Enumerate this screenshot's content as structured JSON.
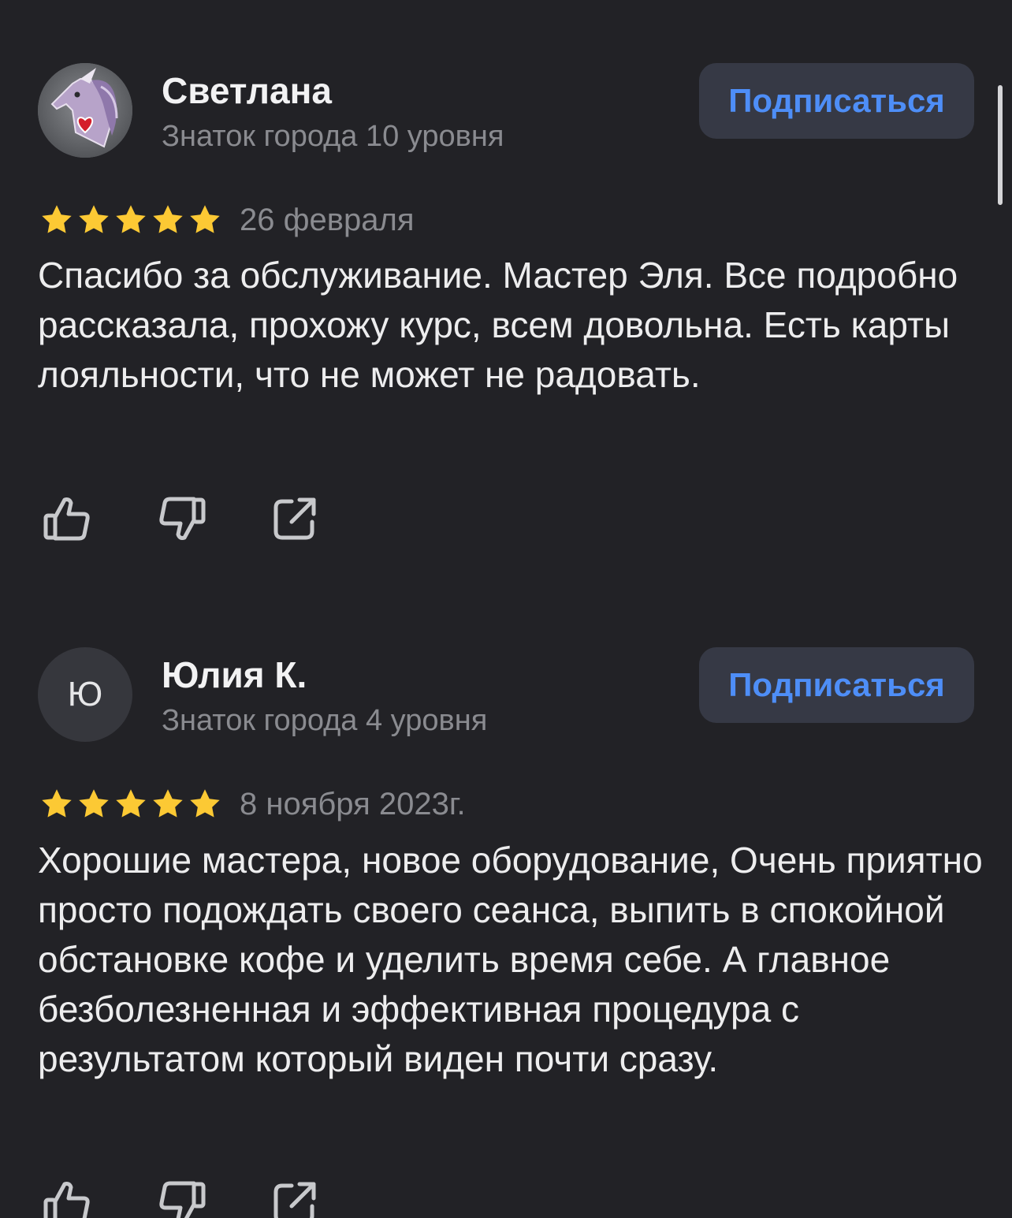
{
  "reviews": [
    {
      "author": {
        "name": "Светлана",
        "level": "Знаток города 10 уровня",
        "avatar_type": "image",
        "avatar_icon": "unicorn-heart-avatar-icon"
      },
      "subscribe_label": "Подписаться",
      "rating": 5,
      "date": "26 февраля",
      "text": "Спасибо за обслуживание. Мастер Эля. Все подробно рассказала, прохожу курс, всем довольна. Есть карты лояльности, что не может не радовать.",
      "actions": [
        "like-icon",
        "dislike-icon",
        "share-icon"
      ]
    },
    {
      "author": {
        "name": "Юлия К.",
        "level": "Знаток города 4 уровня",
        "avatar_type": "letter",
        "avatar_letter": "Ю"
      },
      "subscribe_label": "Подписаться",
      "rating": 5,
      "date": "8 ноября 2023г.",
      "text": "Хорошие мастера, новое оборудование, Очень приятно просто подождать своего сеанса, выпить в спокойной обстановке кофе и уделить время себе. А главное безболезненная и эффективная процедура с результатом который виден почти сразу.",
      "actions": [
        "like-icon",
        "dislike-icon",
        "share-icon"
      ]
    }
  ],
  "colors": {
    "background": "#222226",
    "accent": "#4e8ef7",
    "star": "#fcc934",
    "muted_text": "#8a8b90",
    "button_bg": "#363945"
  }
}
